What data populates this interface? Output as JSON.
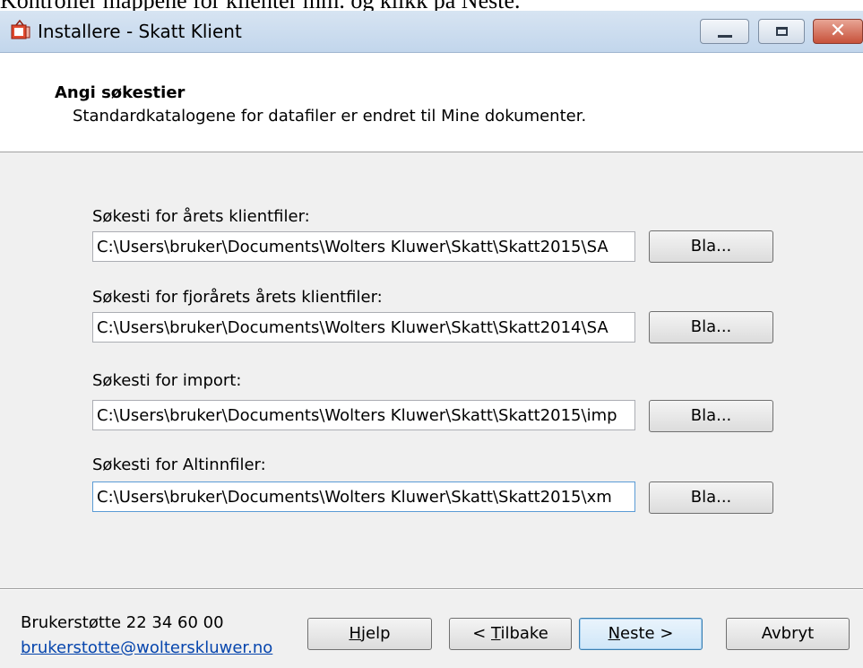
{
  "doc_caption": "Kontroller mappene for klienter mm. og klikk på Neste.",
  "window": {
    "title": "Installere - Skatt Klient",
    "controls": {
      "minimize_icon": "minimize-icon",
      "maximize_icon": "maximize-icon",
      "close_icon": "close-icon"
    }
  },
  "header": {
    "title": "Angi søkestier",
    "subtitle": "Standardkatalogene for datafiler er endret til Mine dokumenter."
  },
  "paths": [
    {
      "label": "Søkesti for årets klientfiler:",
      "value": "C:\\Users\\bruker\\Documents\\Wolters Kluwer\\Skatt\\Skatt2015\\SA",
      "browse": "Bla..."
    },
    {
      "label": "Søkesti for fjorårets årets klientfiler:",
      "value": "C:\\Users\\bruker\\Documents\\Wolters Kluwer\\Skatt\\Skatt2014\\SA",
      "browse": "Bla..."
    },
    {
      "label": "Søkesti for import:",
      "value": "C:\\Users\\bruker\\Documents\\Wolters Kluwer\\Skatt\\Skatt2015\\imp",
      "browse": "Bla..."
    },
    {
      "label": "Søkesti for Altinnfiler:",
      "value": "C:\\Users\\bruker\\Documents\\Wolters Kluwer\\Skatt\\Skatt2015\\xm",
      "browse": "Bla..."
    }
  ],
  "footer": {
    "support_text": "Brukerstøtte 22 34 60 00",
    "support_email": "brukerstotte@wolterskluwer.no",
    "help": {
      "mnemonic": "H",
      "rest": "jelp"
    },
    "back": {
      "prefix": "< ",
      "mnemonic": "T",
      "rest": "ilbake"
    },
    "next": {
      "mnemonic": "N",
      "rest": "este >"
    },
    "cancel": "Avbryt"
  },
  "colors": {
    "link": "#0645ad",
    "titlebar": "#c2d6ec",
    "close": "#c7513a"
  }
}
